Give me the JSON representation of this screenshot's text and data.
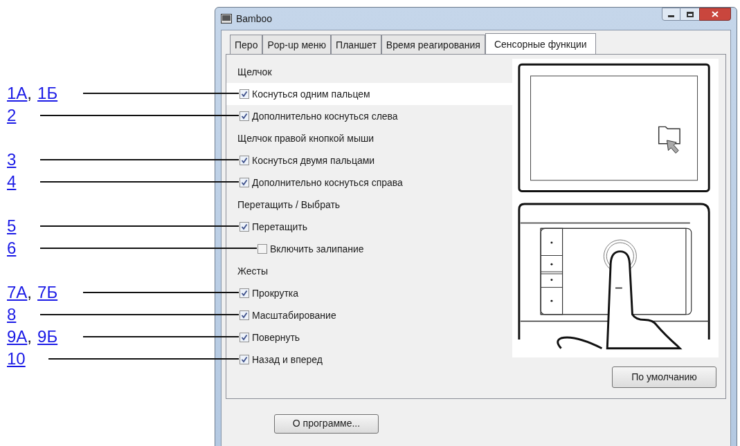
{
  "window": {
    "title": "Bamboo"
  },
  "tabs": [
    {
      "label": "Перо",
      "selected": false
    },
    {
      "label": "Pop-up меню",
      "selected": false
    },
    {
      "label": "Планшет",
      "selected": false
    },
    {
      "label": "Время реагирования",
      "selected": false
    },
    {
      "label": "Сенсорные функции",
      "selected": true
    }
  ],
  "callout_separator": ",",
  "rows": [
    {
      "kind": "header",
      "label": "Щелчок"
    },
    {
      "kind": "checkbox",
      "label": "Коснуться одним пальцем",
      "checked": true,
      "selected": true,
      "callouts": [
        "1А",
        "1Б"
      ]
    },
    {
      "kind": "checkbox",
      "label": "Дополнительно коснуться слева",
      "checked": true,
      "selected": false,
      "callouts": [
        "2"
      ]
    },
    {
      "kind": "header",
      "label": "Щелчок правой кнопкой мыши"
    },
    {
      "kind": "checkbox",
      "label": "Коснуться двумя пальцами",
      "checked": true,
      "selected": false,
      "callouts": [
        "3"
      ]
    },
    {
      "kind": "checkbox",
      "label": "Дополнительно коснуться справа",
      "checked": true,
      "selected": false,
      "callouts": [
        "4"
      ]
    },
    {
      "kind": "header",
      "label": "Перетащить / Выбрать"
    },
    {
      "kind": "checkbox",
      "label": "Перетащить",
      "checked": true,
      "selected": false,
      "callouts": [
        "5"
      ]
    },
    {
      "kind": "subcheckbox",
      "label": "Включить залипание",
      "checked": false,
      "selected": false,
      "callouts": [
        "6"
      ]
    },
    {
      "kind": "header",
      "label": "Жесты"
    },
    {
      "kind": "checkbox",
      "label": "Прокрутка",
      "checked": true,
      "selected": false,
      "callouts": [
        "7А",
        "7Б"
      ]
    },
    {
      "kind": "checkbox",
      "label": "Масштабирование",
      "checked": true,
      "selected": false,
      "callouts": [
        "8"
      ]
    },
    {
      "kind": "checkbox",
      "label": "Повернуть",
      "checked": true,
      "selected": false,
      "callouts": [
        "9А",
        "9Б"
      ]
    },
    {
      "kind": "checkbox",
      "label": "Назад и вперед",
      "checked": true,
      "selected": false,
      "callouts": [
        "10"
      ]
    }
  ],
  "default_button": "По умолчанию",
  "about_button": "О программе..."
}
